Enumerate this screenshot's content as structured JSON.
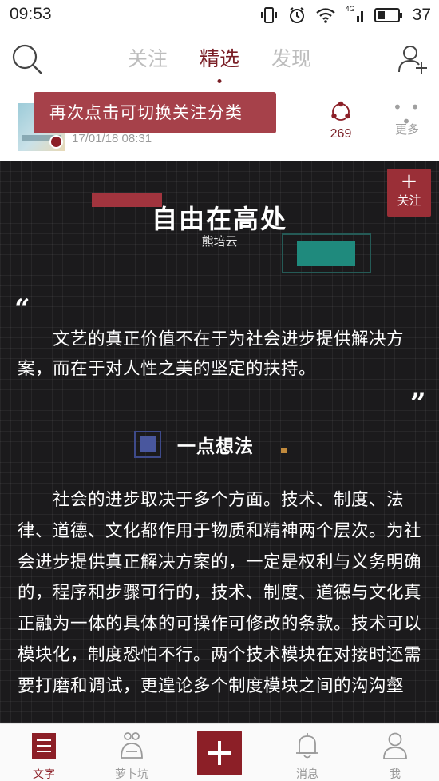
{
  "status_bar": {
    "time": "09:53",
    "network_label": "4G",
    "battery_level": "37"
  },
  "top_nav": {
    "tabs": [
      {
        "label": "关注",
        "active": false
      },
      {
        "label": "精选",
        "active": true
      },
      {
        "label": "发现",
        "active": false
      }
    ]
  },
  "post_header": {
    "tooltip": "再次点击可切换关注分类",
    "post_time": "17/01/18 08:31",
    "share_count": "269",
    "more_label": "更多",
    "more_dots": "• • •"
  },
  "article": {
    "follow_icon": "+",
    "follow_label": "关注",
    "title": "自由在高处",
    "author": "熊培云",
    "quote_open": "“",
    "quote_text": "文艺的真正价值不在于为社会进步提供解决方案，而在于对人性之美的坚定的扶持。",
    "quote_close": "”",
    "section_title": "一点想法",
    "body": "社会的进步取决于多个方面。技术、制度、法律、道德、文化都作用于物质和精神两个层次。为社会进步提供真正解决方案的，一定是权利与义务明确的，程序和步骤可行的，技术、制度、道德与文化真正融为一体的具体的可操作可修改的条款。技术可以模块化，制度恐怕不行。两个技术模块在对接时还需要打磨和调试，更遑论多个制度模块之间的沟沟壑"
  },
  "bottom_nav": {
    "items": [
      {
        "label": "文字",
        "icon": "text-icon",
        "active": true
      },
      {
        "label": "萝卜坑",
        "icon": "radish-pit-icon",
        "active": false
      },
      {
        "label": "消息",
        "icon": "bell-icon",
        "active": false
      },
      {
        "label": "我",
        "icon": "profile-icon",
        "active": false
      }
    ]
  },
  "colors": {
    "brand": "#8c1f27",
    "tooltip_bg": "#a6414a",
    "article_bg": "#1b1a1c",
    "teal_accent": "#1f8a7d",
    "blue_accent": "#49579e"
  }
}
